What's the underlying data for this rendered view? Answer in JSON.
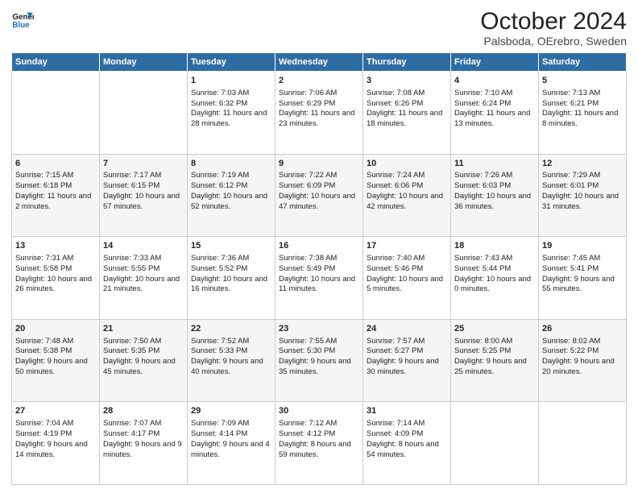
{
  "header": {
    "logo_line1": "General",
    "logo_line2": "Blue",
    "title": "October 2024",
    "subtitle": "Palsboda, OErebro, Sweden"
  },
  "columns": [
    "Sunday",
    "Monday",
    "Tuesday",
    "Wednesday",
    "Thursday",
    "Friday",
    "Saturday"
  ],
  "weeks": [
    [
      {
        "day": "",
        "sunrise": "",
        "sunset": "",
        "daylight": ""
      },
      {
        "day": "",
        "sunrise": "",
        "sunset": "",
        "daylight": ""
      },
      {
        "day": "1",
        "sunrise": "Sunrise: 7:03 AM",
        "sunset": "Sunset: 6:32 PM",
        "daylight": "Daylight: 11 hours and 28 minutes."
      },
      {
        "day": "2",
        "sunrise": "Sunrise: 7:06 AM",
        "sunset": "Sunset: 6:29 PM",
        "daylight": "Daylight: 11 hours and 23 minutes."
      },
      {
        "day": "3",
        "sunrise": "Sunrise: 7:08 AM",
        "sunset": "Sunset: 6:26 PM",
        "daylight": "Daylight: 11 hours and 18 minutes."
      },
      {
        "day": "4",
        "sunrise": "Sunrise: 7:10 AM",
        "sunset": "Sunset: 6:24 PM",
        "daylight": "Daylight: 11 hours and 13 minutes."
      },
      {
        "day": "5",
        "sunrise": "Sunrise: 7:13 AM",
        "sunset": "Sunset: 6:21 PM",
        "daylight": "Daylight: 11 hours and 8 minutes."
      }
    ],
    [
      {
        "day": "6",
        "sunrise": "Sunrise: 7:15 AM",
        "sunset": "Sunset: 6:18 PM",
        "daylight": "Daylight: 11 hours and 2 minutes."
      },
      {
        "day": "7",
        "sunrise": "Sunrise: 7:17 AM",
        "sunset": "Sunset: 6:15 PM",
        "daylight": "Daylight: 10 hours and 57 minutes."
      },
      {
        "day": "8",
        "sunrise": "Sunrise: 7:19 AM",
        "sunset": "Sunset: 6:12 PM",
        "daylight": "Daylight: 10 hours and 52 minutes."
      },
      {
        "day": "9",
        "sunrise": "Sunrise: 7:22 AM",
        "sunset": "Sunset: 6:09 PM",
        "daylight": "Daylight: 10 hours and 47 minutes."
      },
      {
        "day": "10",
        "sunrise": "Sunrise: 7:24 AM",
        "sunset": "Sunset: 6:06 PM",
        "daylight": "Daylight: 10 hours and 42 minutes."
      },
      {
        "day": "11",
        "sunrise": "Sunrise: 7:26 AM",
        "sunset": "Sunset: 6:03 PM",
        "daylight": "Daylight: 10 hours and 36 minutes."
      },
      {
        "day": "12",
        "sunrise": "Sunrise: 7:29 AM",
        "sunset": "Sunset: 6:01 PM",
        "daylight": "Daylight: 10 hours and 31 minutes."
      }
    ],
    [
      {
        "day": "13",
        "sunrise": "Sunrise: 7:31 AM",
        "sunset": "Sunset: 5:58 PM",
        "daylight": "Daylight: 10 hours and 26 minutes."
      },
      {
        "day": "14",
        "sunrise": "Sunrise: 7:33 AM",
        "sunset": "Sunset: 5:55 PM",
        "daylight": "Daylight: 10 hours and 21 minutes."
      },
      {
        "day": "15",
        "sunrise": "Sunrise: 7:36 AM",
        "sunset": "Sunset: 5:52 PM",
        "daylight": "Daylight: 10 hours and 16 minutes."
      },
      {
        "day": "16",
        "sunrise": "Sunrise: 7:38 AM",
        "sunset": "Sunset: 5:49 PM",
        "daylight": "Daylight: 10 hours and 11 minutes."
      },
      {
        "day": "17",
        "sunrise": "Sunrise: 7:40 AM",
        "sunset": "Sunset: 5:46 PM",
        "daylight": "Daylight: 10 hours and 5 minutes."
      },
      {
        "day": "18",
        "sunrise": "Sunrise: 7:43 AM",
        "sunset": "Sunset: 5:44 PM",
        "daylight": "Daylight: 10 hours and 0 minutes."
      },
      {
        "day": "19",
        "sunrise": "Sunrise: 7:45 AM",
        "sunset": "Sunset: 5:41 PM",
        "daylight": "Daylight: 9 hours and 55 minutes."
      }
    ],
    [
      {
        "day": "20",
        "sunrise": "Sunrise: 7:48 AM",
        "sunset": "Sunset: 5:38 PM",
        "daylight": "Daylight: 9 hours and 50 minutes."
      },
      {
        "day": "21",
        "sunrise": "Sunrise: 7:50 AM",
        "sunset": "Sunset: 5:35 PM",
        "daylight": "Daylight: 9 hours and 45 minutes."
      },
      {
        "day": "22",
        "sunrise": "Sunrise: 7:52 AM",
        "sunset": "Sunset: 5:33 PM",
        "daylight": "Daylight: 9 hours and 40 minutes."
      },
      {
        "day": "23",
        "sunrise": "Sunrise: 7:55 AM",
        "sunset": "Sunset: 5:30 PM",
        "daylight": "Daylight: 9 hours and 35 minutes."
      },
      {
        "day": "24",
        "sunrise": "Sunrise: 7:57 AM",
        "sunset": "Sunset: 5:27 PM",
        "daylight": "Daylight: 9 hours and 30 minutes."
      },
      {
        "day": "25",
        "sunrise": "Sunrise: 8:00 AM",
        "sunset": "Sunset: 5:25 PM",
        "daylight": "Daylight: 9 hours and 25 minutes."
      },
      {
        "day": "26",
        "sunrise": "Sunrise: 8:02 AM",
        "sunset": "Sunset: 5:22 PM",
        "daylight": "Daylight: 9 hours and 20 minutes."
      }
    ],
    [
      {
        "day": "27",
        "sunrise": "Sunrise: 7:04 AM",
        "sunset": "Sunset: 4:19 PM",
        "daylight": "Daylight: 9 hours and 14 minutes."
      },
      {
        "day": "28",
        "sunrise": "Sunrise: 7:07 AM",
        "sunset": "Sunset: 4:17 PM",
        "daylight": "Daylight: 9 hours and 9 minutes."
      },
      {
        "day": "29",
        "sunrise": "Sunrise: 7:09 AM",
        "sunset": "Sunset: 4:14 PM",
        "daylight": "Daylight: 9 hours and 4 minutes."
      },
      {
        "day": "30",
        "sunrise": "Sunrise: 7:12 AM",
        "sunset": "Sunset: 4:12 PM",
        "daylight": "Daylight: 8 hours and 59 minutes."
      },
      {
        "day": "31",
        "sunrise": "Sunrise: 7:14 AM",
        "sunset": "Sunset: 4:09 PM",
        "daylight": "Daylight: 8 hours and 54 minutes."
      },
      {
        "day": "",
        "sunrise": "",
        "sunset": "",
        "daylight": ""
      },
      {
        "day": "",
        "sunrise": "",
        "sunset": "",
        "daylight": ""
      }
    ]
  ]
}
